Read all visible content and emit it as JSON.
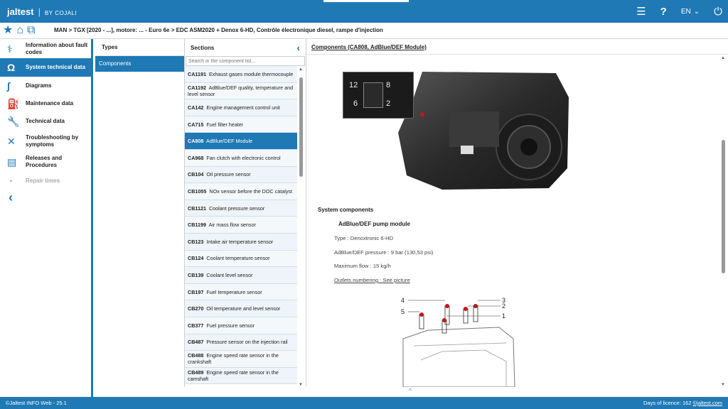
{
  "app": {
    "logo": "jaltest",
    "by": "BY COJALI",
    "lang": "EN"
  },
  "breadcrumb": "MAN > TGX [2020 - ...], motore: ... - Euro 6e > EDC ASM2020 + Denox 6-HD, Contrôle électronique diesel, rampe d'injection",
  "sidebar": {
    "items": [
      {
        "label": "Information about fault codes",
        "icon": "stethoscope-icon"
      },
      {
        "label": "System technical data",
        "icon": "omega-icon",
        "active": true
      },
      {
        "label": "Diagrams",
        "icon": "diagram-icon"
      },
      {
        "label": "Maintenance data",
        "icon": "oil-can-icon"
      },
      {
        "label": "Technical data",
        "icon": "wrench-icon"
      },
      {
        "label": "Troubleshooting by symptoms",
        "icon": "tools-icon"
      },
      {
        "label": "Releases and Procedures",
        "icon": "document-icon"
      },
      {
        "label": "Repair times",
        "icon": "clock-icon",
        "disabled": true
      }
    ]
  },
  "types": {
    "header": "Types",
    "items": [
      "Components"
    ]
  },
  "sections": {
    "header": "Sections",
    "search_placeholder": "Search in the component list...",
    "items": [
      {
        "code": "CA1191",
        "name": "Exhaust gases module thermocouple"
      },
      {
        "code": "CA1192",
        "name": "AdBlue/DEF quality, temperature and level sensor"
      },
      {
        "code": "CA142",
        "name": "Engine management control unit"
      },
      {
        "code": "CA715",
        "name": "Fuel filter heater"
      },
      {
        "code": "CA808",
        "name": "AdBlue/DEF Module",
        "active": true
      },
      {
        "code": "CA968",
        "name": "Fan clutch with electronic control"
      },
      {
        "code": "CB104",
        "name": "Oil pressure sensor"
      },
      {
        "code": "CB1055",
        "name": "NOx sensor before the DOC catalyst"
      },
      {
        "code": "CB1121",
        "name": "Coolant pressure sensor"
      },
      {
        "code": "CB1199",
        "name": "Air mass flow sensor"
      },
      {
        "code": "CB123",
        "name": "Intake air temperature sensor"
      },
      {
        "code": "CB124",
        "name": "Coolant temperature sensor"
      },
      {
        "code": "CB139",
        "name": "Coolant level sensor"
      },
      {
        "code": "CB197",
        "name": "Fuel temperature sensor"
      },
      {
        "code": "CB270",
        "name": "Oil temperature and level sensor"
      },
      {
        "code": "CB377",
        "name": "Fuel pressure sensor"
      },
      {
        "code": "CB487",
        "name": "Pressure sensor on the injection rail"
      },
      {
        "code": "CB488",
        "name": "Engine speed rate sensor in the crankshaft"
      },
      {
        "code": "CB489",
        "name": "Engine speed rate sensor in the camshaft"
      }
    ]
  },
  "content": {
    "title": "Components (CA808, AdBlue/DEF Module)",
    "pin_labels": [
      "12",
      "8",
      "6",
      "2"
    ],
    "system_components": "System components",
    "module_title": "AdBlue/DEF pump module",
    "specs": [
      "Type : Denoxtronic 6-HD",
      "AdBlue/DEF pressure : 9 bar (130,53 psi)",
      "Maximum flow : 15 kg/h",
      "Outlets numbering : See picture"
    ],
    "outlet_labels": [
      "4",
      "5",
      "3",
      "2",
      "1"
    ]
  },
  "footer": {
    "copyright": "©Jaltest INFO Web - 25.1",
    "licence": "Days of licence: 162",
    "site": "©jaltest.com"
  }
}
